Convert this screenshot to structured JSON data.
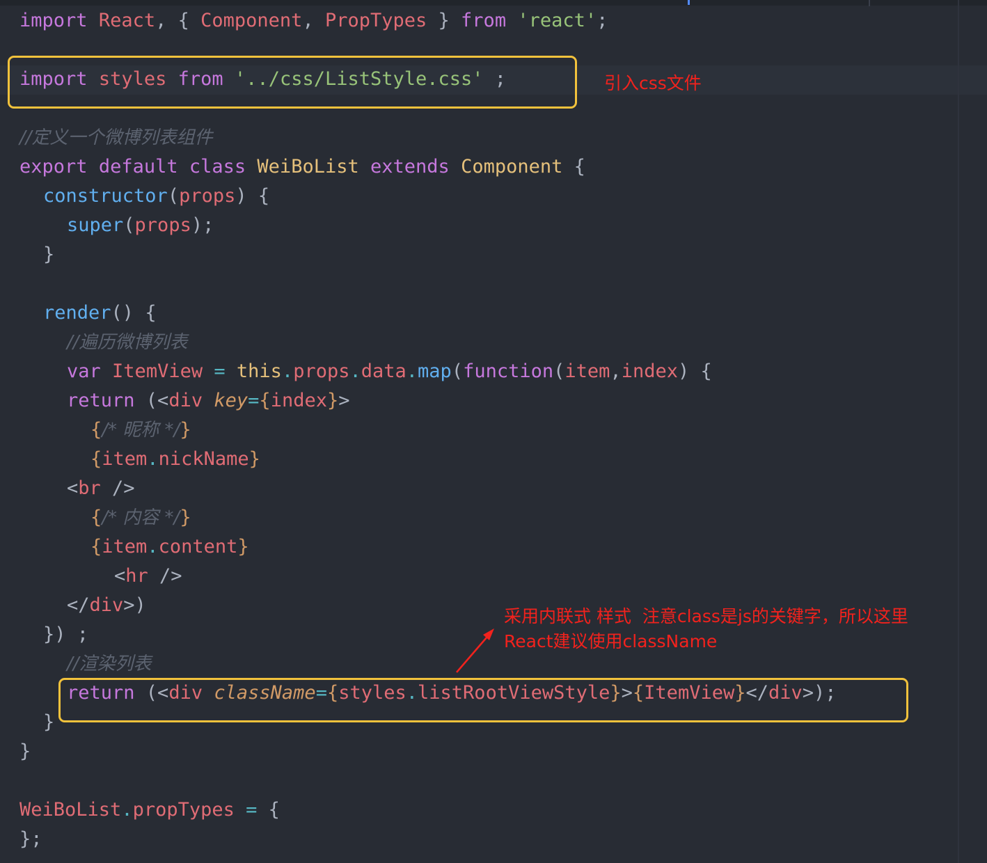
{
  "editor": {
    "lines": [
      {
        "segments": [
          {
            "t": "import",
            "c": "kw"
          },
          {
            "t": " ",
            "c": "punc"
          },
          {
            "t": "React",
            "c": "var"
          },
          {
            "t": ", { ",
            "c": "punc"
          },
          {
            "t": "Component",
            "c": "var"
          },
          {
            "t": ", ",
            "c": "punc"
          },
          {
            "t": "PropTypes",
            "c": "var"
          },
          {
            "t": " } ",
            "c": "punc"
          },
          {
            "t": "from",
            "c": "kw"
          },
          {
            "t": " ",
            "c": "punc"
          },
          {
            "t": "'react'",
            "c": "str"
          },
          {
            "t": ";",
            "c": "punc"
          }
        ]
      },
      {
        "segments": [
          {
            "t": "import",
            "c": "kw"
          },
          {
            "t": " ",
            "c": "punc"
          },
          {
            "t": "styles",
            "c": "var"
          },
          {
            "t": " ",
            "c": "punc"
          },
          {
            "t": "from",
            "c": "kw"
          },
          {
            "t": " ",
            "c": "punc"
          },
          {
            "t": "'../css/ListStyle.css'",
            "c": "str"
          },
          {
            "t": " ;",
            "c": "punc"
          }
        ]
      },
      {
        "segments": [
          {
            "t": "//定义一个微博列表组件",
            "c": "cmt"
          }
        ]
      },
      {
        "segments": [
          {
            "t": "export",
            "c": "kw"
          },
          {
            "t": " ",
            "c": "punc"
          },
          {
            "t": "default",
            "c": "kw"
          },
          {
            "t": " ",
            "c": "punc"
          },
          {
            "t": "class",
            "c": "kw"
          },
          {
            "t": " ",
            "c": "punc"
          },
          {
            "t": "WeiBoList",
            "c": "cls"
          },
          {
            "t": " ",
            "c": "punc"
          },
          {
            "t": "extends",
            "c": "kw"
          },
          {
            "t": " ",
            "c": "punc"
          },
          {
            "t": "Component",
            "c": "cls"
          },
          {
            "t": " {",
            "c": "punc"
          }
        ]
      },
      {
        "segments": [
          {
            "t": "constructor",
            "c": "fn"
          },
          {
            "t": "(",
            "c": "punc"
          },
          {
            "t": "props",
            "c": "var"
          },
          {
            "t": ") {",
            "c": "punc"
          }
        ]
      },
      {
        "segments": [
          {
            "t": "super",
            "c": "fn"
          },
          {
            "t": "(",
            "c": "punc"
          },
          {
            "t": "props",
            "c": "var"
          },
          {
            "t": ");",
            "c": "punc"
          }
        ]
      },
      {
        "segments": [
          {
            "t": "}",
            "c": "punc"
          }
        ]
      },
      {
        "segments": [
          {
            "t": "render",
            "c": "fn"
          },
          {
            "t": "() {",
            "c": "punc"
          }
        ]
      },
      {
        "segments": [
          {
            "t": "//遍历微博列表",
            "c": "cmt"
          }
        ]
      },
      {
        "segments": [
          {
            "t": "var",
            "c": "kw"
          },
          {
            "t": " ",
            "c": "punc"
          },
          {
            "t": "ItemView",
            "c": "var"
          },
          {
            "t": " ",
            "c": "punc"
          },
          {
            "t": "=",
            "c": "op"
          },
          {
            "t": " ",
            "c": "punc"
          },
          {
            "t": "this",
            "c": "cls"
          },
          {
            "t": ".",
            "c": "op"
          },
          {
            "t": "props",
            "c": "var"
          },
          {
            "t": ".",
            "c": "op"
          },
          {
            "t": "data",
            "c": "var"
          },
          {
            "t": ".",
            "c": "op"
          },
          {
            "t": "map",
            "c": "fn"
          },
          {
            "t": "(",
            "c": "punc"
          },
          {
            "t": "function",
            "c": "kw"
          },
          {
            "t": "(",
            "c": "punc"
          },
          {
            "t": "item",
            "c": "var"
          },
          {
            "t": ",",
            "c": "punc"
          },
          {
            "t": "index",
            "c": "var"
          },
          {
            "t": ") {",
            "c": "punc"
          }
        ]
      },
      {
        "segments": [
          {
            "t": "return",
            "c": "kw"
          },
          {
            "t": " (<",
            "c": "punc"
          },
          {
            "t": "div",
            "c": "tag"
          },
          {
            "t": " ",
            "c": "punc"
          },
          {
            "t": "key",
            "c": "attr"
          },
          {
            "t": "=",
            "c": "op"
          },
          {
            "t": "{",
            "c": "brace"
          },
          {
            "t": "index",
            "c": "var"
          },
          {
            "t": "}",
            "c": "brace"
          },
          {
            "t": ">",
            "c": "punc"
          }
        ]
      },
      {
        "segments": [
          {
            "t": "{",
            "c": "brace"
          },
          {
            "t": "/* 昵称 */",
            "c": "cmt"
          },
          {
            "t": "}",
            "c": "brace"
          }
        ]
      },
      {
        "segments": [
          {
            "t": "{",
            "c": "brace"
          },
          {
            "t": "item",
            "c": "var"
          },
          {
            "t": ".",
            "c": "op"
          },
          {
            "t": "nickName",
            "c": "var"
          },
          {
            "t": "}",
            "c": "brace"
          }
        ]
      },
      {
        "segments": [
          {
            "t": "<",
            "c": "punc"
          },
          {
            "t": "br",
            "c": "tag"
          },
          {
            "t": " />",
            "c": "punc"
          }
        ]
      },
      {
        "segments": [
          {
            "t": "{",
            "c": "brace"
          },
          {
            "t": "/* 内容 */",
            "c": "cmt"
          },
          {
            "t": "}",
            "c": "brace"
          }
        ]
      },
      {
        "segments": [
          {
            "t": "{",
            "c": "brace"
          },
          {
            "t": "item",
            "c": "var"
          },
          {
            "t": ".",
            "c": "op"
          },
          {
            "t": "content",
            "c": "var"
          },
          {
            "t": "}",
            "c": "brace"
          }
        ]
      },
      {
        "segments": [
          {
            "t": "<",
            "c": "punc"
          },
          {
            "t": "hr",
            "c": "tag"
          },
          {
            "t": " />",
            "c": "punc"
          }
        ]
      },
      {
        "segments": [
          {
            "t": "</",
            "c": "punc"
          },
          {
            "t": "div",
            "c": "tag"
          },
          {
            "t": ">)",
            "c": "punc"
          }
        ]
      },
      {
        "segments": [
          {
            "t": "}) ;",
            "c": "punc"
          }
        ]
      },
      {
        "segments": [
          {
            "t": "//渲染列表",
            "c": "cmt"
          }
        ]
      },
      {
        "segments": [
          {
            "t": "return",
            "c": "kw"
          },
          {
            "t": " (<",
            "c": "punc"
          },
          {
            "t": "div",
            "c": "tag"
          },
          {
            "t": " ",
            "c": "punc"
          },
          {
            "t": "className",
            "c": "attr"
          },
          {
            "t": "=",
            "c": "op"
          },
          {
            "t": "{",
            "c": "brace"
          },
          {
            "t": "styles",
            "c": "var"
          },
          {
            "t": ".",
            "c": "op"
          },
          {
            "t": "listRootViewStyle",
            "c": "var"
          },
          {
            "t": "}",
            "c": "brace"
          },
          {
            "t": ">",
            "c": "punc"
          },
          {
            "t": "{",
            "c": "brace"
          },
          {
            "t": "ItemView",
            "c": "var"
          },
          {
            "t": "}",
            "c": "brace"
          },
          {
            "t": "</",
            "c": "punc"
          },
          {
            "t": "div",
            "c": "tag"
          },
          {
            "t": ">);",
            "c": "punc"
          }
        ]
      },
      {
        "segments": [
          {
            "t": "}",
            "c": "punc"
          }
        ]
      },
      {
        "segments": [
          {
            "t": "}",
            "c": "punc"
          }
        ]
      },
      {
        "segments": [
          {
            "t": "WeiBoList",
            "c": "var"
          },
          {
            "t": ".",
            "c": "op"
          },
          {
            "t": "propTypes",
            "c": "var"
          },
          {
            "t": " ",
            "c": "punc"
          },
          {
            "t": "=",
            "c": "op"
          },
          {
            "t": " {",
            "c": "punc"
          }
        ]
      },
      {
        "segments": [
          {
            "t": "};",
            "c": "punc"
          }
        ]
      }
    ]
  },
  "annotations": {
    "import_css": "引入css文件",
    "inline_style_line1": "采用内联式 样式  注意class是js的关键字，所以这里",
    "inline_style_line2": "React建议使用className"
  },
  "colors": {
    "background": "#282c34",
    "highlight_box": "#f2c23c",
    "annotation_red": "#f2221d",
    "keyword": "#c678dd",
    "variable": "#e06c75",
    "string": "#98c379",
    "class_name": "#e5c07b",
    "function": "#61afef",
    "comment": "#5c6370"
  }
}
